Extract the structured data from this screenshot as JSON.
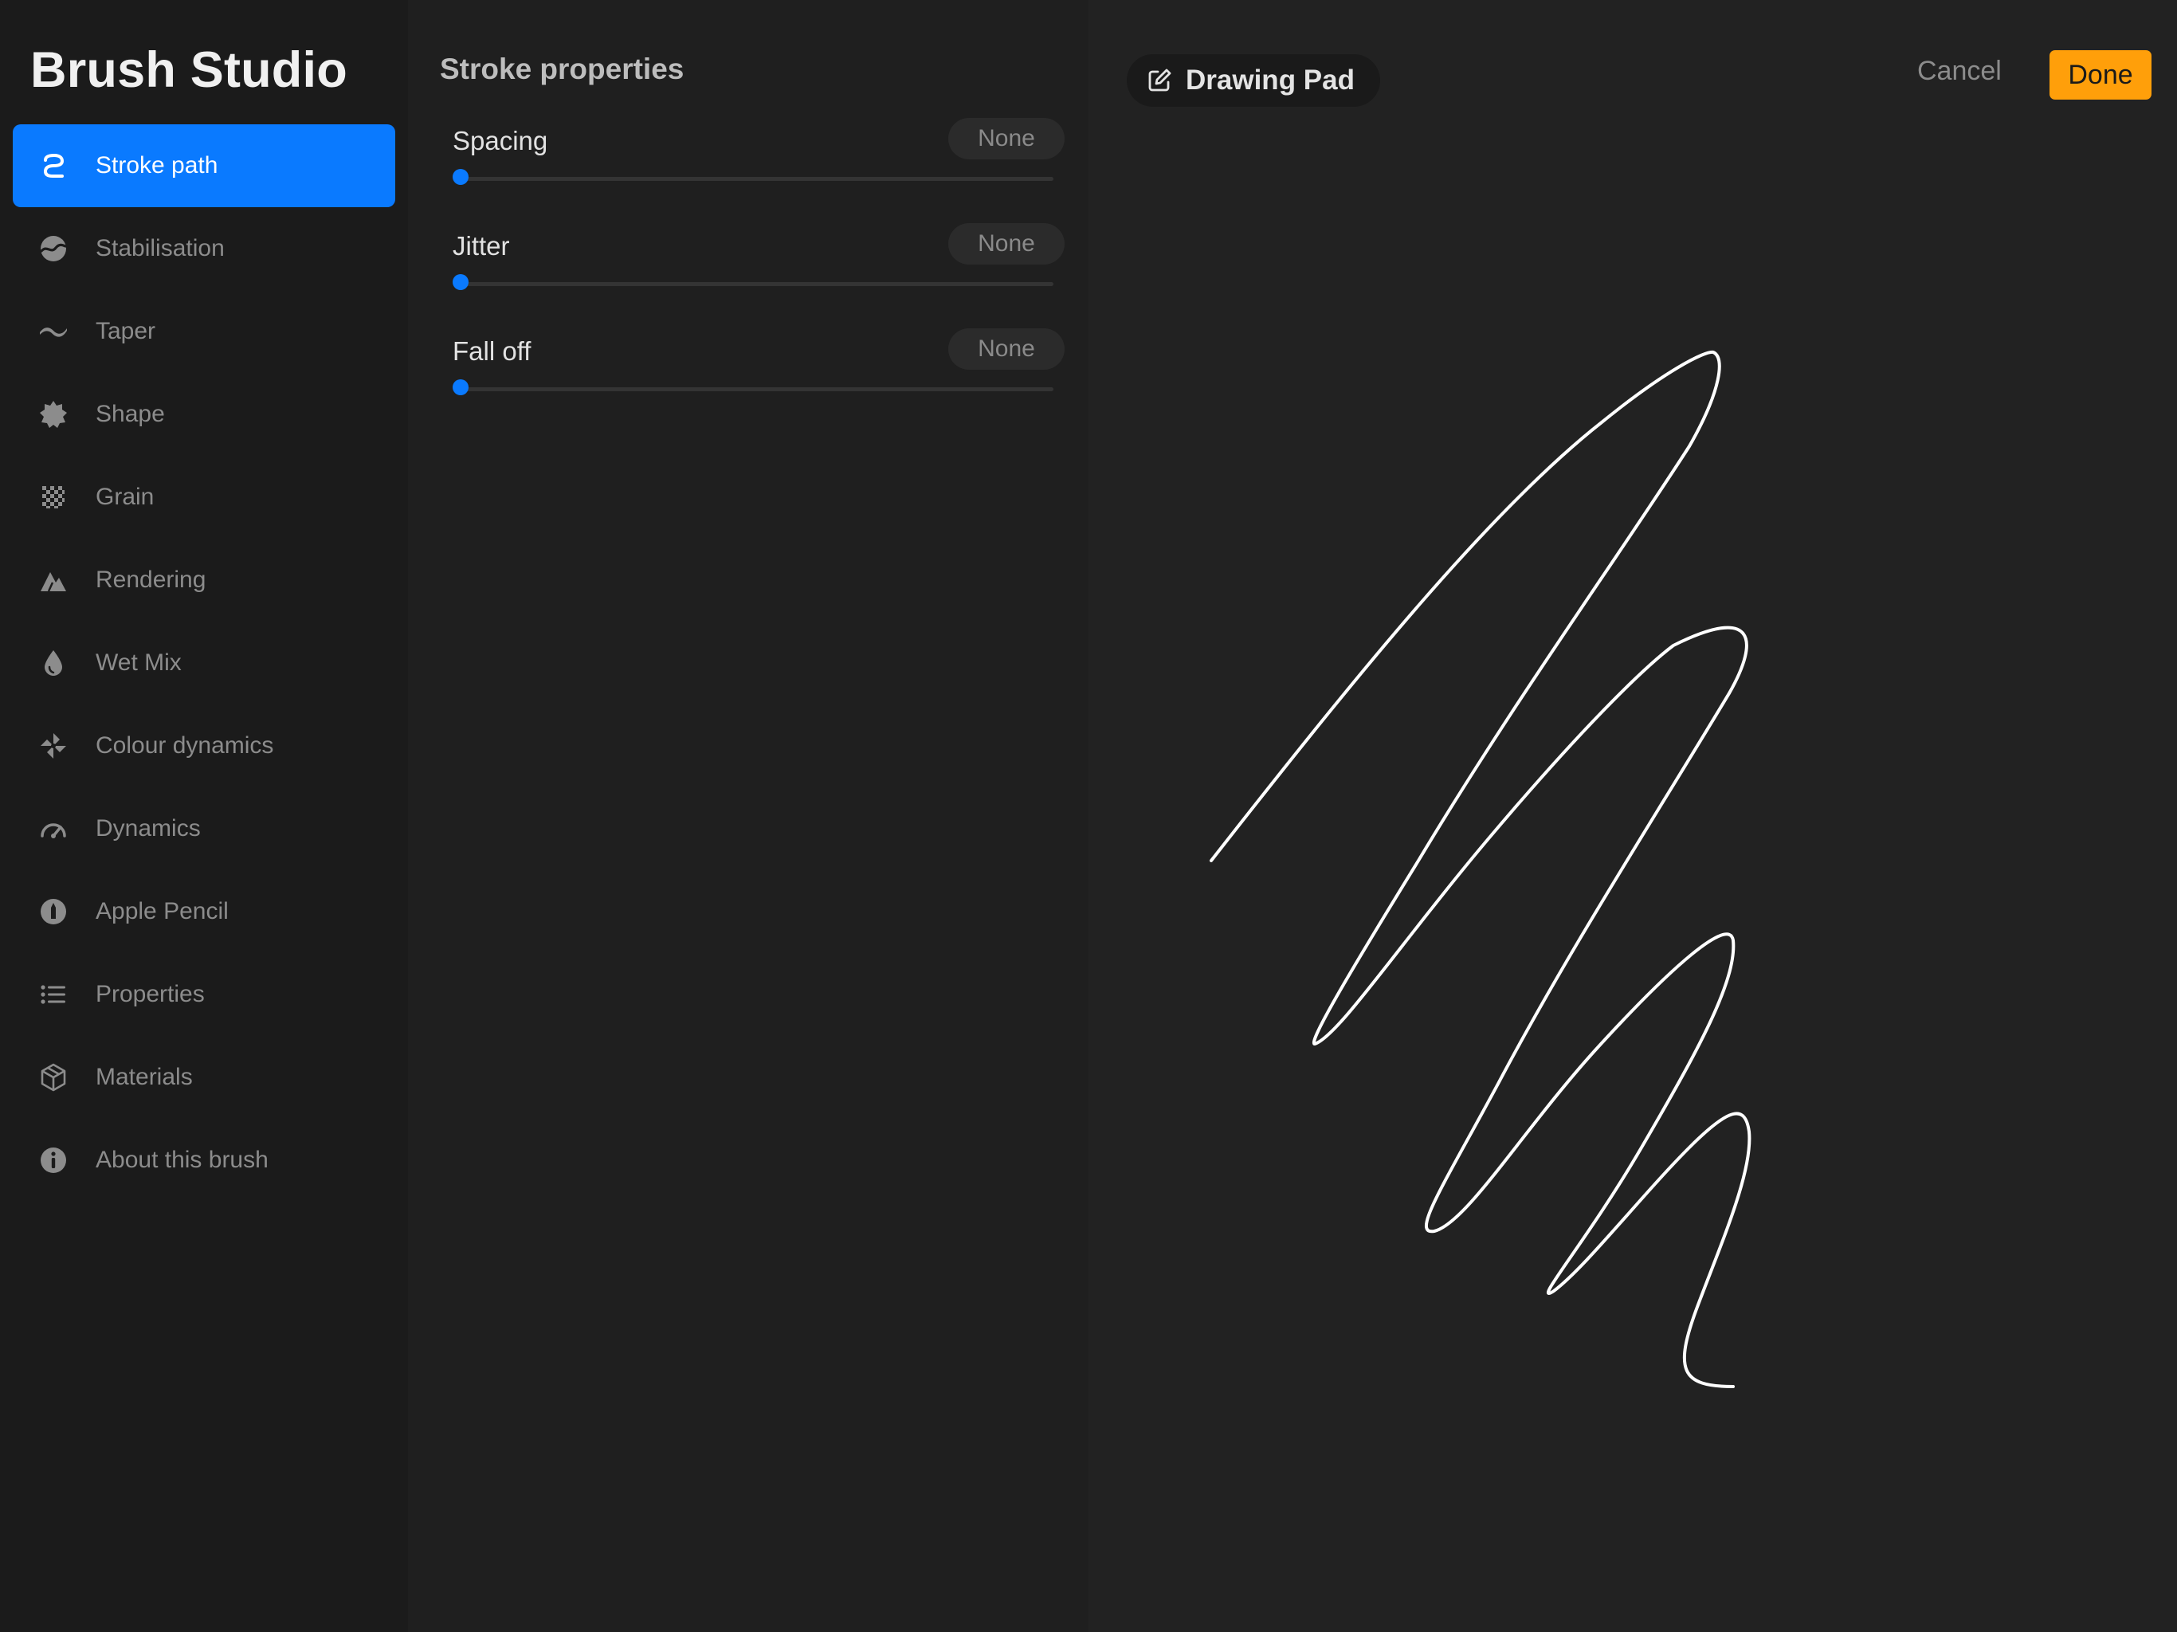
{
  "app": {
    "title": "Brush Studio"
  },
  "sidebar": {
    "active_index": 0,
    "items": [
      {
        "label": "Stroke path",
        "icon": "stroke-path-icon"
      },
      {
        "label": "Stabilisation",
        "icon": "stabilisation-icon"
      },
      {
        "label": "Taper",
        "icon": "taper-icon"
      },
      {
        "label": "Shape",
        "icon": "shape-icon"
      },
      {
        "label": "Grain",
        "icon": "grain-icon"
      },
      {
        "label": "Rendering",
        "icon": "rendering-icon"
      },
      {
        "label": "Wet Mix",
        "icon": "wet-mix-icon"
      },
      {
        "label": "Colour dynamics",
        "icon": "colour-dynamics-icon"
      },
      {
        "label": "Dynamics",
        "icon": "dynamics-icon"
      },
      {
        "label": "Apple Pencil",
        "icon": "apple-pencil-icon"
      },
      {
        "label": "Properties",
        "icon": "properties-icon"
      },
      {
        "label": "Materials",
        "icon": "materials-icon"
      },
      {
        "label": "About this brush",
        "icon": "info-icon"
      }
    ]
  },
  "settings": {
    "section_title": "Stroke properties",
    "rows": [
      {
        "label": "Spacing",
        "value": "None",
        "level": 0
      },
      {
        "label": "Jitter",
        "value": "None",
        "level": 0
      },
      {
        "label": "Fall off",
        "value": "None",
        "level": 0
      }
    ]
  },
  "pad": {
    "label": "Drawing Pad",
    "icon": "edit-icon"
  },
  "actions": {
    "cancel_label": "Cancel",
    "done_label": "Done"
  },
  "colors": {
    "accent": "#0a7aff",
    "done": "#ff9f0a",
    "sidebar_bg": "#1b1b1b",
    "panel_bg": "#1f1f1f",
    "pad_bg": "#222222"
  }
}
